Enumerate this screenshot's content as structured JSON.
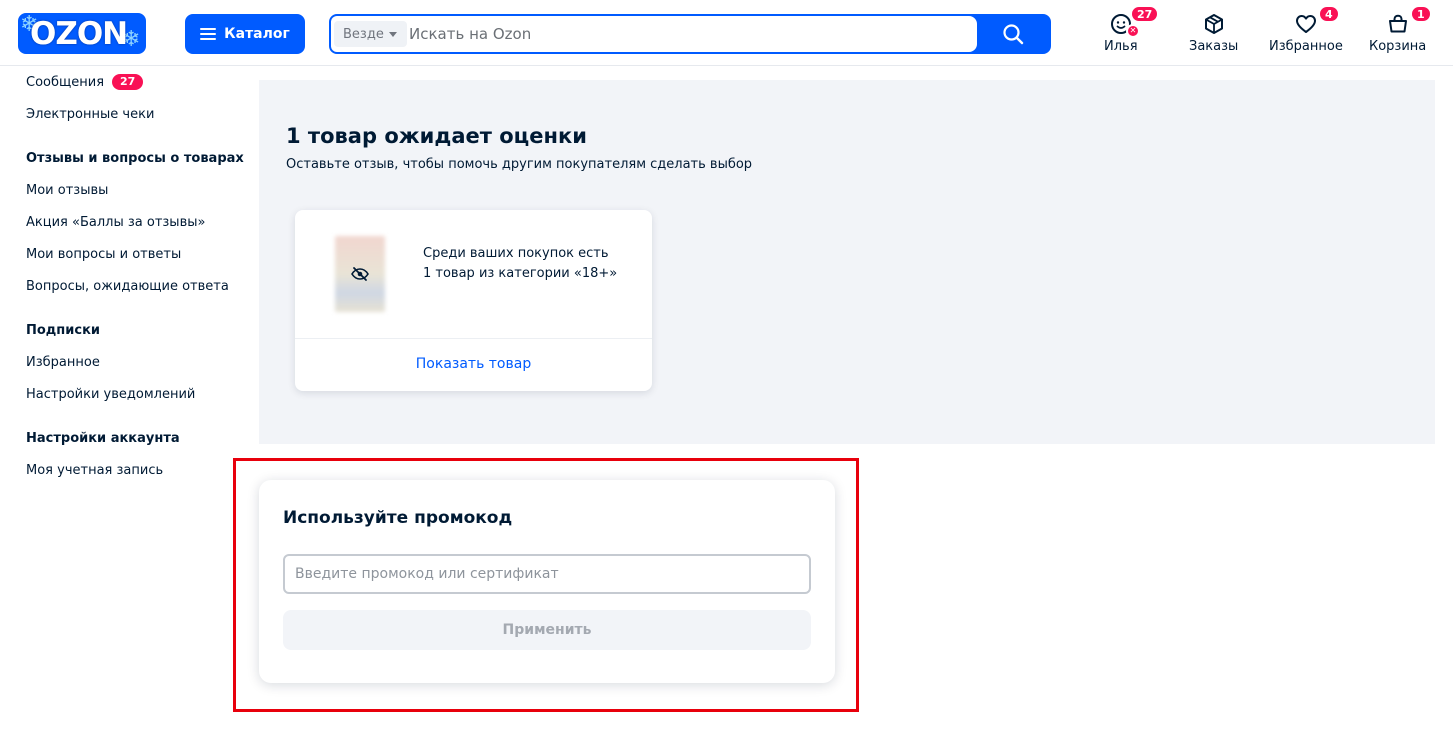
{
  "header": {
    "logo_text": "OZON",
    "catalog_label": "Каталог",
    "search": {
      "scope_label": "Везде",
      "placeholder": "Искать на Ozon",
      "value": ""
    },
    "nav": {
      "profile": {
        "label": "Илья",
        "badge": "27"
      },
      "orders": {
        "label": "Заказы"
      },
      "favorites": {
        "label": "Избранное",
        "badge": "4"
      },
      "cart": {
        "label": "Корзина",
        "badge": "1"
      }
    }
  },
  "sidebar": {
    "messages": {
      "label": "Сообщения",
      "badge": "27"
    },
    "receipts": "Электронные чеки",
    "reviews_heading": "Отзывы и вопросы о товарах",
    "my_reviews": "Мои отзывы",
    "points_promo": "Акция «Баллы за отзывы»",
    "my_questions": "Мои вопросы и ответы",
    "pending_questions": "Вопросы, ожидающие ответа",
    "subscriptions_heading": "Подписки",
    "favorites": "Избранное",
    "notifications": "Настройки уведомлений",
    "account_heading": "Настройки аккаунта",
    "my_account": "Моя учетная запись"
  },
  "review_panel": {
    "title": "1 товар ожидает оценки",
    "subtitle": "Оставьте отзыв, чтобы помочь другим покупателям сделать выбор",
    "card": {
      "text_line1": "Среди ваших покупок есть",
      "text_line2": "1 товар из категории «18+»",
      "show_button": "Показать товар"
    }
  },
  "promo": {
    "title": "Используйте промокод",
    "input_placeholder": "Введите промокод или сертификат",
    "input_value": "",
    "apply_button": "Применить"
  },
  "colors": {
    "brand_blue": "#005bff",
    "badge_pink": "#f91155",
    "highlight_red": "#e8000c",
    "panel_bg": "#f2f4f8"
  }
}
